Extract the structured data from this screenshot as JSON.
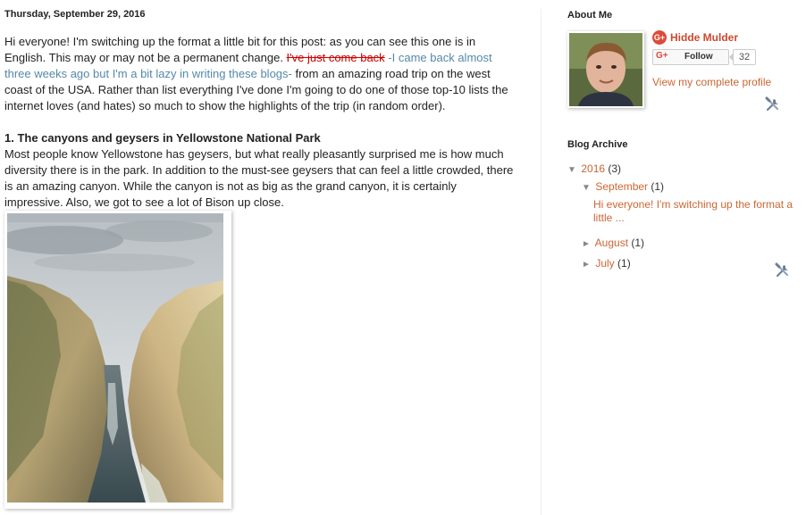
{
  "post": {
    "date": "Thursday, September 29, 2016",
    "intro_start": "Hi everyone! I'm switching up the format a little bit for this post: as you can see this one is in English. This may or may not be a permanent change. ",
    "intro_strike": "I've just come back",
    "intro_blue": " -I came back almost three weeks ago but I'm a bit lazy in writing these blogs-",
    "intro_end": " from an amazing road trip on the west coast of the USA. Rather than list everything I've done I'm going to do one of those top-10 lists the internet loves (and hates) so much to show the highlights of the trip (in random order).",
    "section1_heading": "1. The canyons and geysers in Yellowstone National Park",
    "section1_body": "Most people know Yellowstone has geysers, but what really pleasantly surprised me is how much diversity there is in the park. In addition to the must-see geysers that can feel a little crowded, there is an amazing canyon. While the canyon is not as big as the grand canyon, it is certainly impressive. Also, we got to see a lot of Bison up close."
  },
  "about": {
    "title": "About Me",
    "gplus_badge": "G+",
    "name": "Hidde Mulder",
    "follow_gplus": "G+",
    "follow_label": "Follow",
    "follower_count": "32",
    "profile_link": "View my complete profile"
  },
  "archive": {
    "title": "Blog Archive",
    "years": [
      {
        "toggle": "▼",
        "label": "2016",
        "count": "(3)",
        "months": [
          {
            "toggle": "▼",
            "label": "September",
            "count": "(1)",
            "posts": [
              "Hi everyone! I'm switching up the format a little ..."
            ]
          },
          {
            "toggle": "►",
            "label": "August",
            "count": "(1)"
          },
          {
            "toggle": "►",
            "label": "July",
            "count": "(1)"
          }
        ]
      }
    ]
  },
  "colors": {
    "link": "#cc6633",
    "strike": "#cc0000",
    "aside": "#5588aa",
    "gplus": "#dd4b39"
  },
  "icons": {
    "widget_tools": "wrench-screwdriver-icon"
  }
}
